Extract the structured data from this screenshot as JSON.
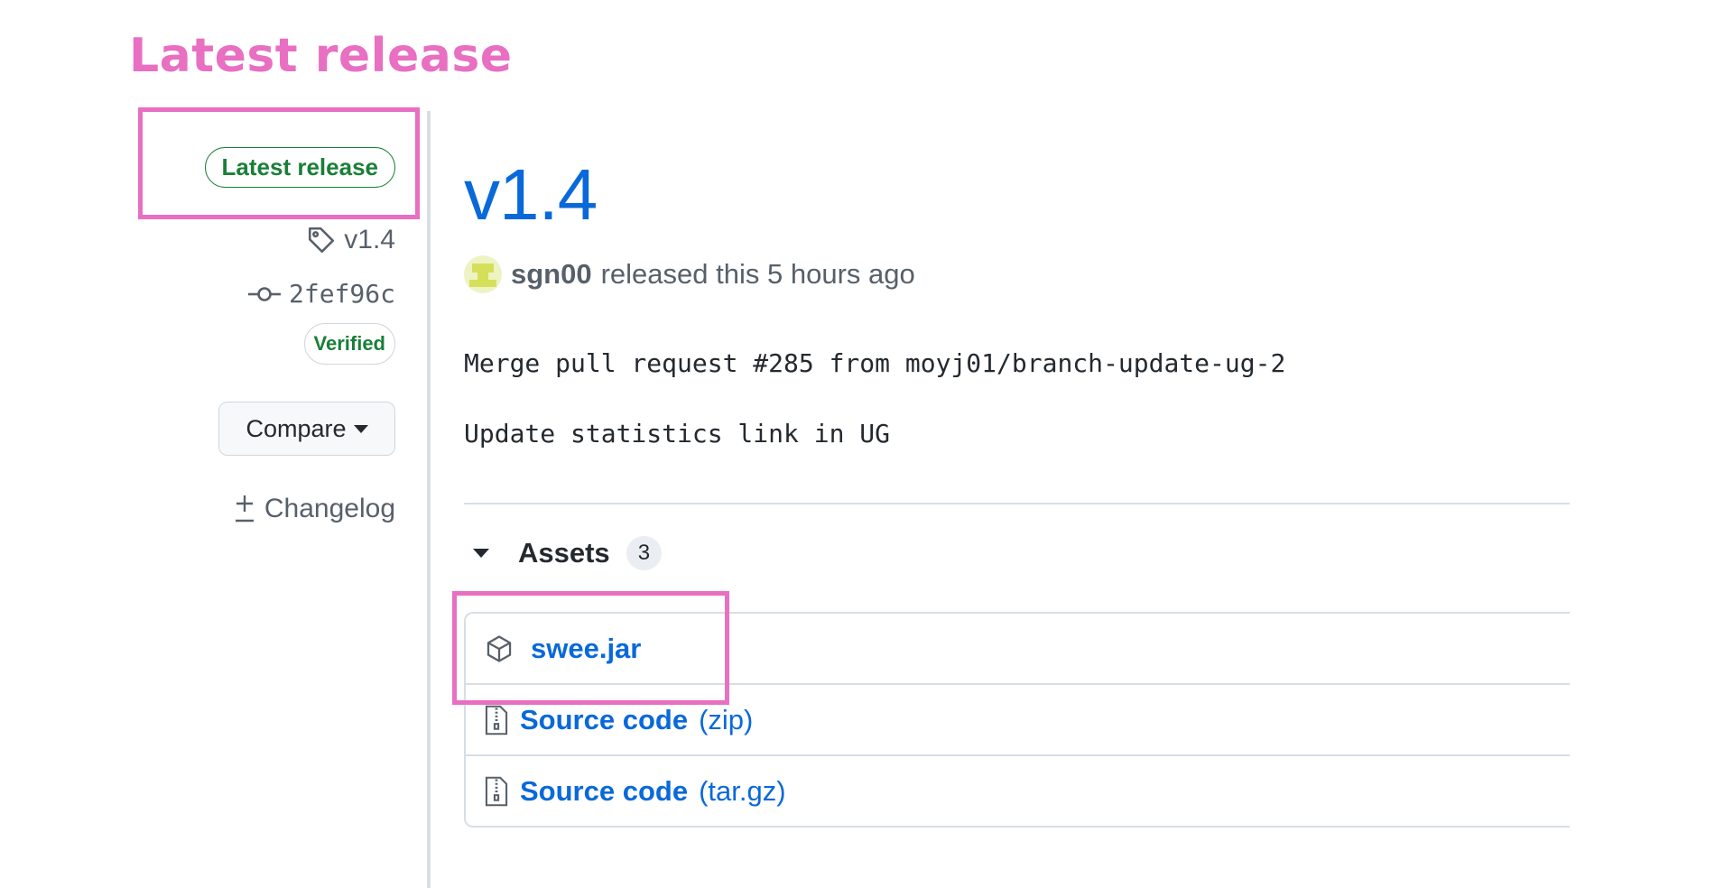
{
  "annotation": {
    "caption": "Latest release"
  },
  "sidebar": {
    "latest_badge": "Latest release",
    "tag": "v1.4",
    "commit": "2fef96c",
    "verified_badge": "Verified",
    "compare_label": "Compare",
    "changelog_label": "Changelog"
  },
  "release": {
    "version": "v1.4",
    "author": "sgn00",
    "released_text": "released this 5 hours ago",
    "body_line1": "Merge pull request #285 from moyj01/branch-update-ug-2",
    "body_line2": "Update statistics link in UG"
  },
  "assets": {
    "title": "Assets",
    "count": "3",
    "items": [
      {
        "name": "swee.jar",
        "suffix": "",
        "icon": "package-icon"
      },
      {
        "name": "Source code",
        "suffix": "(zip)",
        "icon": "file-zip-icon"
      },
      {
        "name": "Source code",
        "suffix": "(tar.gz)",
        "icon": "file-zip-icon"
      }
    ]
  },
  "colors": {
    "annotation_pink": "#e86fc1",
    "link_blue": "#0969da",
    "success_green": "#1a7f37"
  }
}
